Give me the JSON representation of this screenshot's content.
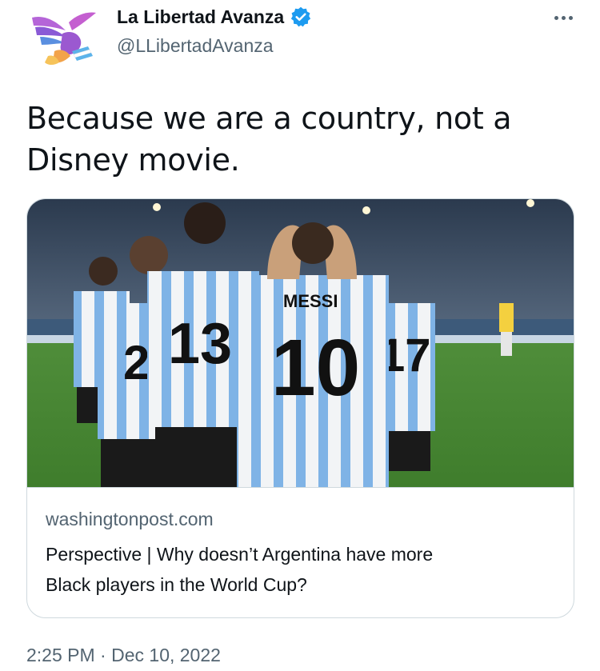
{
  "author": {
    "name": "La Libertad Avanza",
    "handle": "@LLibertadAvanza",
    "verified": true,
    "avatar_icon": "winged-lion-logo",
    "verified_color": "#1d9bf0"
  },
  "more_icon": "ellipsis-icon",
  "tweet": {
    "text_line1": "Because we are a country, not a",
    "text_line2": "Disney movie."
  },
  "card": {
    "image_alt": "Argentina football players in striped jerseys on pitch",
    "jersey_back_name": "MESSI",
    "jersey_back_number": "10",
    "domain": "washingtonpost.com",
    "title_line1": "Perspective | Why doesn’t Argentina have more",
    "title_line2": "Black players in the World Cup?"
  },
  "timestamp": {
    "time": "2:25 PM",
    "separator": "·",
    "date": "Dec 10, 2022"
  }
}
